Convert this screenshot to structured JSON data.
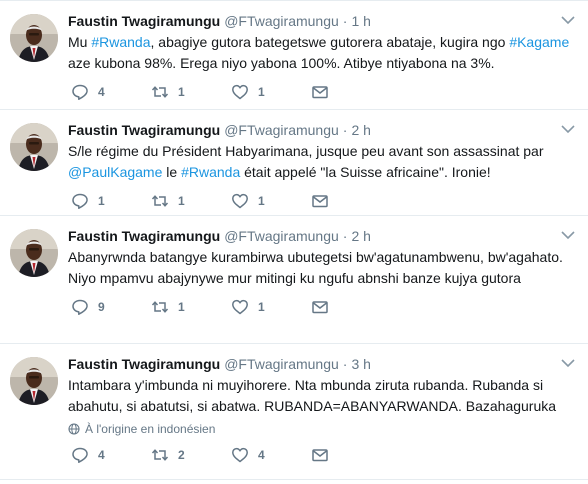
{
  "tweets": [
    {
      "name": "Faustin Twagiramungu",
      "handle": "@FTwagiramungu",
      "separator": "·",
      "time": "1 h",
      "segments": [
        {
          "t": "Mu ",
          "link": false
        },
        {
          "t": "#Rwanda",
          "link": true
        },
        {
          "t": ", abagiye gutora bategetswe gutorera abataje, kugira ngo ",
          "link": false
        },
        {
          "t": "#Kagame",
          "link": true
        },
        {
          "t": " aze kubona 98%. Erega niyo yabona 100%. Atibye ntiyabona na 3%.",
          "link": false
        }
      ],
      "translate": "",
      "replies": "4",
      "retweets": "1",
      "likes": "1"
    },
    {
      "name": "Faustin Twagiramungu",
      "handle": "@FTwagiramungu",
      "separator": "·",
      "time": "2 h",
      "segments": [
        {
          "t": "S/le régime du Président Habyarimana, jusque peu avant son assassinat par ",
          "link": false
        },
        {
          "t": "@PaulKagame",
          "link": true
        },
        {
          "t": " le ",
          "link": false
        },
        {
          "t": "#Rwanda",
          "link": true
        },
        {
          "t": " était appelé \"la Suisse africaine\". Ironie!",
          "link": false
        }
      ],
      "translate": "",
      "replies": "1",
      "retweets": "1",
      "likes": "1"
    },
    {
      "name": "Faustin Twagiramungu",
      "handle": "@FTwagiramungu",
      "separator": "·",
      "time": "2 h",
      "segments": [
        {
          "t": "Abanyrwnda batangye kurambirwa ubutegetsi bw'agatunambwenu, bw'agahato. Niyo mpamvu abajynywe mur mitingi ku ngufu abnshi banze kujya gutora",
          "link": false
        }
      ],
      "translate": "",
      "replies": "9",
      "retweets": "1",
      "likes": "1"
    },
    {
      "name": "Faustin Twagiramungu",
      "handle": "@FTwagiramungu",
      "separator": "·",
      "time": "3 h",
      "segments": [
        {
          "t": "Intambara y'imbunda ni muyihorere. Nta mbunda ziruta rubanda. Rubanda si abahutu, si abatutsi, si abatwa. RUBANDA=ABANYARWANDA. Bazahaguruka",
          "link": false
        }
      ],
      "translate": "À l'origine en indonésien",
      "replies": "4",
      "retweets": "2",
      "likes": "4"
    }
  ],
  "icons": {
    "reply": "reply-icon",
    "retweet": "retweet-icon",
    "like": "heart-icon",
    "message": "envelope-icon",
    "menu": "chevron-down-icon",
    "globe": "globe-icon"
  },
  "colors": {
    "link": "#1b95e0",
    "muted": "#657786",
    "divider": "#e6ecf0",
    "text": "#14171a"
  }
}
